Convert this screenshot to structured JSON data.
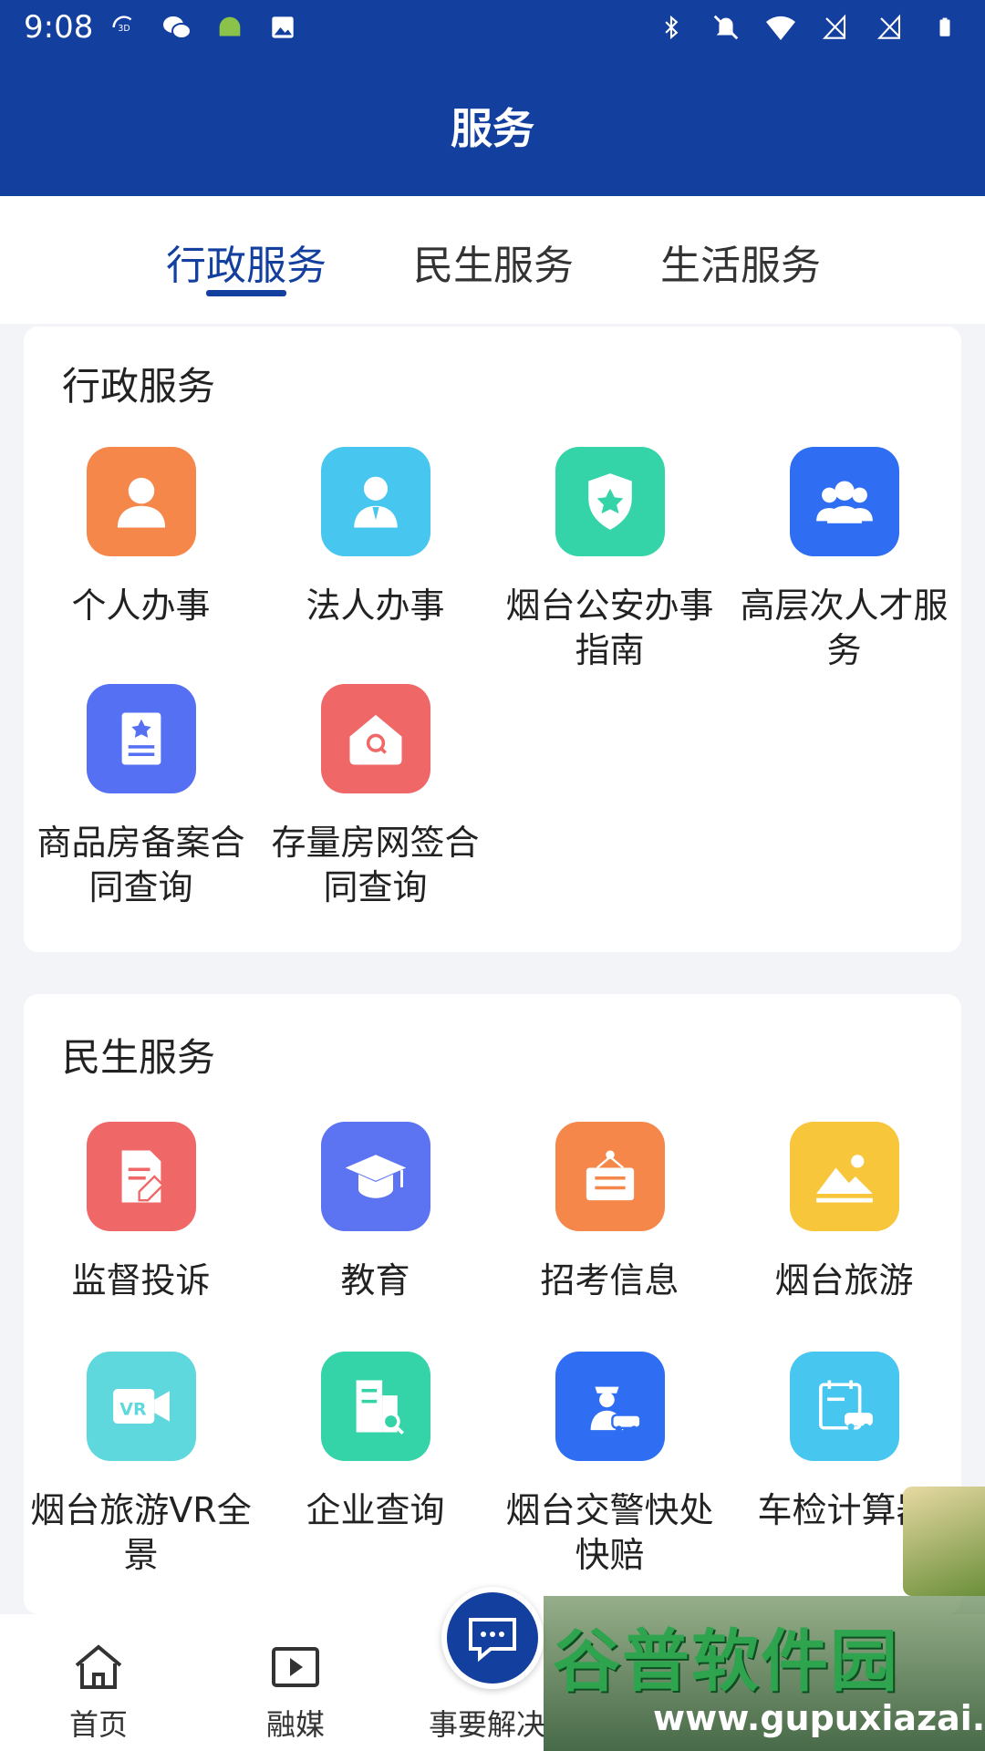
{
  "status_bar": {
    "time": "9:08"
  },
  "header": {
    "title": "服务"
  },
  "tabs": [
    {
      "label": "行政服务",
      "active": true
    },
    {
      "label": "民生服务",
      "active": false
    },
    {
      "label": "生活服务",
      "active": false
    }
  ],
  "sections": [
    {
      "title": "行政服务",
      "items": [
        {
          "label": "个人办事",
          "icon": "person-icon",
          "color": "#f5874a"
        },
        {
          "label": "法人办事",
          "icon": "officer-icon",
          "color": "#47c6f0"
        },
        {
          "label": "烟台公安办事指南",
          "icon": "police-shield-icon",
          "color": "#35d3a8"
        },
        {
          "label": "高层次人才服务",
          "icon": "group-icon",
          "color": "#2f6ef3"
        },
        {
          "label": "商品房备案合同查询",
          "icon": "certificate-icon",
          "color": "#5670f3"
        },
        {
          "label": "存量房网签合同查询",
          "icon": "house-search-icon",
          "color": "#f06767"
        }
      ]
    },
    {
      "title": "民生服务",
      "items": [
        {
          "label": "监督投诉",
          "icon": "document-edit-icon",
          "color": "#f06767"
        },
        {
          "label": "教育",
          "icon": "graduation-cap-icon",
          "color": "#5c74f2"
        },
        {
          "label": "招考信息",
          "icon": "notice-board-icon",
          "color": "#f5874a"
        },
        {
          "label": "烟台旅游",
          "icon": "landscape-icon",
          "color": "#f8c63a"
        },
        {
          "label": "烟台旅游VR全景",
          "icon": "vr-camera-icon",
          "color": "#5ed8dc"
        },
        {
          "label": "企业查询",
          "icon": "building-search-icon",
          "color": "#35d3a8"
        },
        {
          "label": "烟台交警快处快赔",
          "icon": "traffic-police-icon",
          "color": "#2f6ef3"
        },
        {
          "label": "车检计算器",
          "icon": "car-calendar-icon",
          "color": "#47c6f0"
        }
      ]
    }
  ],
  "bottom_nav": [
    {
      "label": "首页",
      "icon": "home-icon"
    },
    {
      "label": "融媒",
      "icon": "play-icon"
    },
    {
      "label": "事要解决",
      "icon": "chat-icon"
    }
  ],
  "watermark": {
    "text": "谷普软件园",
    "url": "www.gupuxiazai.com"
  }
}
